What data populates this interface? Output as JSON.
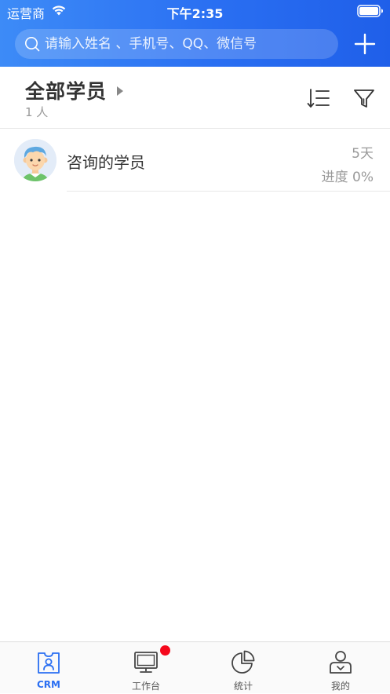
{
  "status_bar": {
    "carrier": "运营商",
    "time": "下午2:35"
  },
  "search": {
    "placeholder": "请输入姓名 、手机号、QQ、微信号",
    "value": ""
  },
  "filter": {
    "category": "全部学员",
    "count": "1 人"
  },
  "students": [
    {
      "name": "咨询的学员",
      "days": "5天",
      "progress": "进度 0%"
    }
  ],
  "tabs": [
    {
      "label": "CRM",
      "icon": "crm-contact-icon",
      "active": true
    },
    {
      "label": "工作台",
      "icon": "monitor-icon",
      "active": false,
      "badge": true
    },
    {
      "label": "统计",
      "icon": "pie-chart-icon",
      "active": false
    },
    {
      "label": "我的",
      "icon": "profile-icon",
      "active": false
    }
  ],
  "colors": {
    "brand_blue": "#2a6ff2",
    "header_gradient_start": "#3d8bf7",
    "header_gradient_end": "#1f5fe9",
    "badge_red": "#f5081c",
    "text_primary": "#333333",
    "text_secondary": "#999999"
  }
}
